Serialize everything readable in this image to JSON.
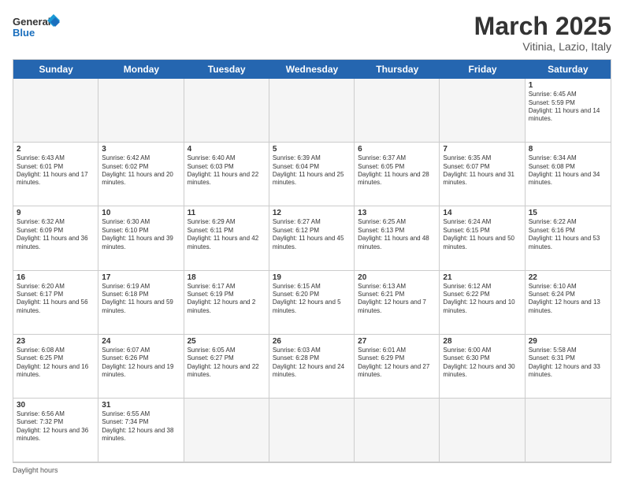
{
  "header": {
    "logo_general": "General",
    "logo_blue": "Blue",
    "month_title": "March 2025",
    "subtitle": "Vitinia, Lazio, Italy"
  },
  "day_headers": [
    "Sunday",
    "Monday",
    "Tuesday",
    "Wednesday",
    "Thursday",
    "Friday",
    "Saturday"
  ],
  "days": [
    {
      "num": "",
      "text": ""
    },
    {
      "num": "",
      "text": ""
    },
    {
      "num": "",
      "text": ""
    },
    {
      "num": "",
      "text": ""
    },
    {
      "num": "",
      "text": ""
    },
    {
      "num": "",
      "text": ""
    },
    {
      "num": "1",
      "text": "Sunrise: 6:45 AM\nSunset: 5:59 PM\nDaylight: 11 hours and 14 minutes."
    },
    {
      "num": "2",
      "text": "Sunrise: 6:43 AM\nSunset: 6:01 PM\nDaylight: 11 hours and 17 minutes."
    },
    {
      "num": "3",
      "text": "Sunrise: 6:42 AM\nSunset: 6:02 PM\nDaylight: 11 hours and 20 minutes."
    },
    {
      "num": "4",
      "text": "Sunrise: 6:40 AM\nSunset: 6:03 PM\nDaylight: 11 hours and 22 minutes."
    },
    {
      "num": "5",
      "text": "Sunrise: 6:39 AM\nSunset: 6:04 PM\nDaylight: 11 hours and 25 minutes."
    },
    {
      "num": "6",
      "text": "Sunrise: 6:37 AM\nSunset: 6:05 PM\nDaylight: 11 hours and 28 minutes."
    },
    {
      "num": "7",
      "text": "Sunrise: 6:35 AM\nSunset: 6:07 PM\nDaylight: 11 hours and 31 minutes."
    },
    {
      "num": "8",
      "text": "Sunrise: 6:34 AM\nSunset: 6:08 PM\nDaylight: 11 hours and 34 minutes."
    },
    {
      "num": "9",
      "text": "Sunrise: 6:32 AM\nSunset: 6:09 PM\nDaylight: 11 hours and 36 minutes."
    },
    {
      "num": "10",
      "text": "Sunrise: 6:30 AM\nSunset: 6:10 PM\nDaylight: 11 hours and 39 minutes."
    },
    {
      "num": "11",
      "text": "Sunrise: 6:29 AM\nSunset: 6:11 PM\nDaylight: 11 hours and 42 minutes."
    },
    {
      "num": "12",
      "text": "Sunrise: 6:27 AM\nSunset: 6:12 PM\nDaylight: 11 hours and 45 minutes."
    },
    {
      "num": "13",
      "text": "Sunrise: 6:25 AM\nSunset: 6:13 PM\nDaylight: 11 hours and 48 minutes."
    },
    {
      "num": "14",
      "text": "Sunrise: 6:24 AM\nSunset: 6:15 PM\nDaylight: 11 hours and 50 minutes."
    },
    {
      "num": "15",
      "text": "Sunrise: 6:22 AM\nSunset: 6:16 PM\nDaylight: 11 hours and 53 minutes."
    },
    {
      "num": "16",
      "text": "Sunrise: 6:20 AM\nSunset: 6:17 PM\nDaylight: 11 hours and 56 minutes."
    },
    {
      "num": "17",
      "text": "Sunrise: 6:19 AM\nSunset: 6:18 PM\nDaylight: 11 hours and 59 minutes."
    },
    {
      "num": "18",
      "text": "Sunrise: 6:17 AM\nSunset: 6:19 PM\nDaylight: 12 hours and 2 minutes."
    },
    {
      "num": "19",
      "text": "Sunrise: 6:15 AM\nSunset: 6:20 PM\nDaylight: 12 hours and 5 minutes."
    },
    {
      "num": "20",
      "text": "Sunrise: 6:13 AM\nSunset: 6:21 PM\nDaylight: 12 hours and 7 minutes."
    },
    {
      "num": "21",
      "text": "Sunrise: 6:12 AM\nSunset: 6:22 PM\nDaylight: 12 hours and 10 minutes."
    },
    {
      "num": "22",
      "text": "Sunrise: 6:10 AM\nSunset: 6:24 PM\nDaylight: 12 hours and 13 minutes."
    },
    {
      "num": "23",
      "text": "Sunrise: 6:08 AM\nSunset: 6:25 PM\nDaylight: 12 hours and 16 minutes."
    },
    {
      "num": "24",
      "text": "Sunrise: 6:07 AM\nSunset: 6:26 PM\nDaylight: 12 hours and 19 minutes."
    },
    {
      "num": "25",
      "text": "Sunrise: 6:05 AM\nSunset: 6:27 PM\nDaylight: 12 hours and 22 minutes."
    },
    {
      "num": "26",
      "text": "Sunrise: 6:03 AM\nSunset: 6:28 PM\nDaylight: 12 hours and 24 minutes."
    },
    {
      "num": "27",
      "text": "Sunrise: 6:01 AM\nSunset: 6:29 PM\nDaylight: 12 hours and 27 minutes."
    },
    {
      "num": "28",
      "text": "Sunrise: 6:00 AM\nSunset: 6:30 PM\nDaylight: 12 hours and 30 minutes."
    },
    {
      "num": "29",
      "text": "Sunrise: 5:58 AM\nSunset: 6:31 PM\nDaylight: 12 hours and 33 minutes."
    },
    {
      "num": "30",
      "text": "Sunrise: 6:56 AM\nSunset: 7:32 PM\nDaylight: 12 hours and 36 minutes."
    },
    {
      "num": "31",
      "text": "Sunrise: 6:55 AM\nSunset: 7:34 PM\nDaylight: 12 hours and 38 minutes."
    },
    {
      "num": "",
      "text": ""
    },
    {
      "num": "",
      "text": ""
    },
    {
      "num": "",
      "text": ""
    },
    {
      "num": "",
      "text": ""
    },
    {
      "num": "",
      "text": ""
    }
  ],
  "bottom_note": "Daylight hours"
}
